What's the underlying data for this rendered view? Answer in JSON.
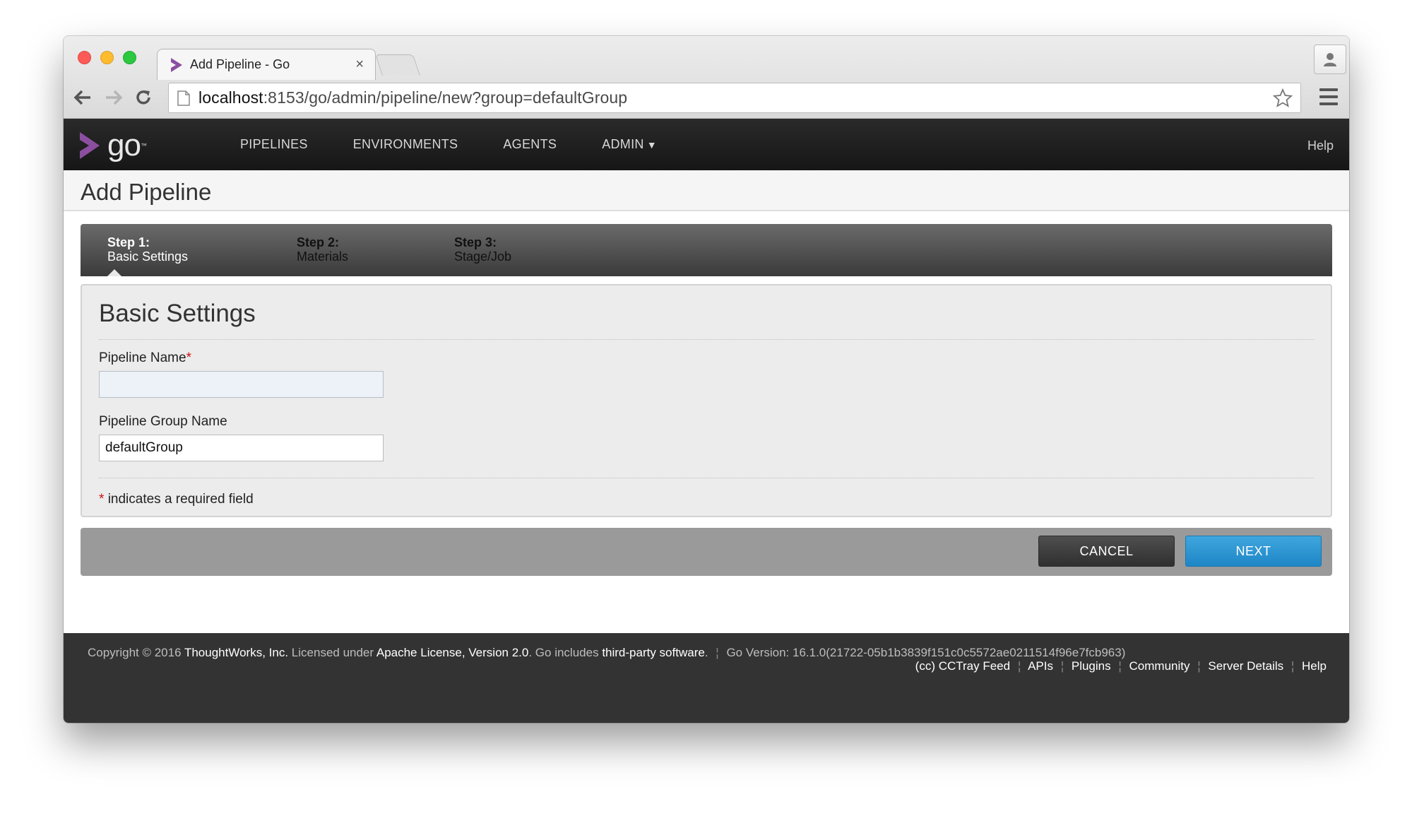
{
  "browser": {
    "tab_title": "Add Pipeline - Go",
    "tab_close": "×",
    "url_host": "localhost",
    "url_rest": ":8153/go/admin/pipeline/new?group=defaultGroup"
  },
  "header": {
    "logo_text": "go",
    "logo_tm": "™",
    "nav": {
      "pipelines": "PIPELINES",
      "environments": "ENVIRONMENTS",
      "agents": "AGENTS",
      "admin": "ADMIN"
    },
    "help": "Help"
  },
  "page": {
    "title": "Add Pipeline"
  },
  "steps": [
    {
      "num": "Step 1:",
      "label": "Basic Settings"
    },
    {
      "num": "Step 2:",
      "label": "Materials"
    },
    {
      "num": "Step 3:",
      "label": "Stage/Job"
    }
  ],
  "form": {
    "heading": "Basic Settings",
    "pipeline_name_label": "Pipeline Name",
    "pipeline_name_value": "",
    "required_mark": "*",
    "group_label": "Pipeline Group Name",
    "group_value": "defaultGroup",
    "required_note": "indicates a required field"
  },
  "actions": {
    "cancel": "CANCEL",
    "next": "NEXT"
  },
  "footer": {
    "copyright": "Copyright © 2016",
    "company": "ThoughtWorks, Inc.",
    "licensed": "Licensed under",
    "license": "Apache License, Version 2.0",
    "includes": ". Go includes",
    "third_party": "third-party software",
    "period": ".",
    "version": "Go Version: 16.1.0(21722-05b1b3839f151c0c5572ae0211514f96e7fcb963)",
    "links": {
      "cctray": "(cc) CCTray Feed",
      "apis": "APIs",
      "plugins": "Plugins",
      "community": "Community",
      "server_details": "Server Details",
      "help": "Help"
    }
  },
  "colors": {
    "accent_next": "#2590d0",
    "go_logo_purple": "#8c4fa0"
  }
}
